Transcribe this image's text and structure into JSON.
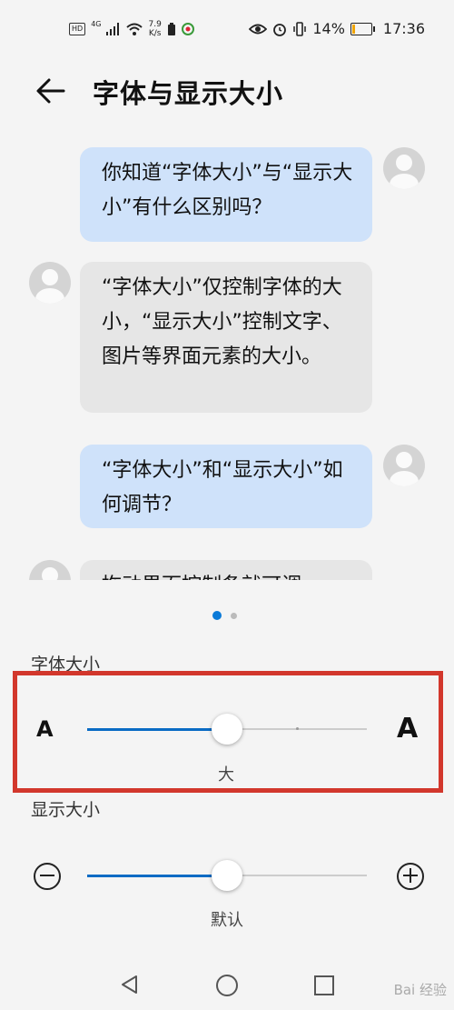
{
  "status_bar": {
    "hd": "HD",
    "network": "4G",
    "speed_value": "7.9",
    "speed_unit": "K/s",
    "battery": "14%",
    "battery_level": 0.14,
    "time": "17:36"
  },
  "header": {
    "title": "字体与显示大小"
  },
  "messages": [
    {
      "from": "user",
      "text": "你知道“字体大小”与“显示大小”有什么区别吗？"
    },
    {
      "from": "assistant",
      "text": "“字体大小”仅控制字体的大小，“显示大小”控制文字、图片等界面元素的大小。"
    },
    {
      "from": "user",
      "text": "“字体大小”和“显示大小”如何调节？"
    },
    {
      "from": "assistant",
      "text": "拖动界面控制条就可调"
    }
  ],
  "page_indicator": {
    "count": 2,
    "active": 0
  },
  "font_size": {
    "label": "字体大小",
    "small_icon": "A",
    "large_icon": "A",
    "value_label": "大",
    "steps": 5,
    "selected_step": 2
  },
  "display_size": {
    "label": "显示大小",
    "minus_icon": "minus-circle-icon",
    "plus_icon": "plus-circle-icon",
    "value_label": "默认",
    "level": 0.5
  },
  "nav_bar": {
    "back_icon": "triangle-back-icon",
    "home_icon": "circle-home-icon",
    "recent_icon": "square-recent-icon"
  },
  "watermark": "Bai 经验",
  "colors": {
    "accent": "#0a6bc4",
    "highlight_border": "#d2372c",
    "outgoing_bubble": "#cfe2fa",
    "incoming_bubble": "#e6e6e6"
  }
}
